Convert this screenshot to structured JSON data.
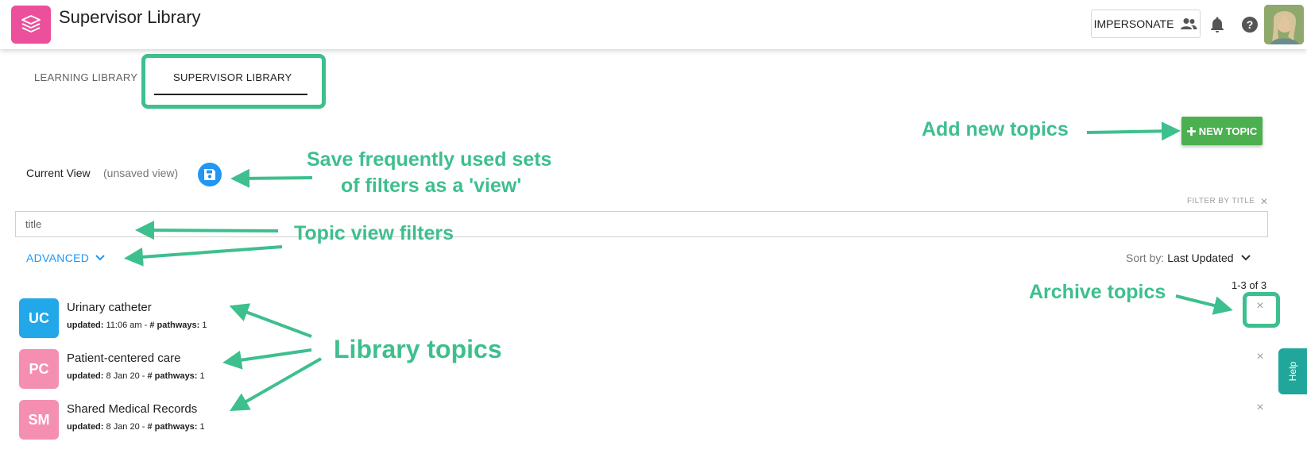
{
  "app": {
    "title": "Supervisor Library"
  },
  "header": {
    "impersonate_label": "IMPERSONATE",
    "icons": [
      "layers-book-icon",
      "people-icon",
      "bell-icon",
      "help-circle-icon"
    ]
  },
  "tabs": [
    {
      "label": "LEARNING LIBRARY",
      "active": false
    },
    {
      "label": "SUPERVISOR LIBRARY",
      "active": true
    }
  ],
  "toolbar": {
    "new_topic_label": "NEW TOPIC"
  },
  "view": {
    "current_label": "Current View",
    "state_label": "(unsaved view)"
  },
  "filter": {
    "caption": "FILTER BY TITLE",
    "clear_symbol": "✕",
    "placeholder": "title",
    "value": ""
  },
  "advanced_label": "ADVANCED",
  "sort": {
    "label": "Sort by:",
    "value": "Last Updated"
  },
  "results_count": "1-3 of 3",
  "topics": [
    {
      "initials": "UC",
      "title": "Urinary catheter",
      "updated": "11:06 am",
      "pathways": "1",
      "color": "#22a7e8"
    },
    {
      "initials": "PC",
      "title": "Patient-centered care",
      "updated": "8 Jan 20",
      "pathways": "1",
      "color": "#f48fb1"
    },
    {
      "initials": "SM",
      "title": "Shared Medical Records",
      "updated": "8 Jan 20",
      "pathways": "1",
      "color": "#f48fb1"
    }
  ],
  "meta_labels": {
    "updated": "updated:",
    "separator": " - ",
    "pathways": "# pathways:"
  },
  "archive_symbol": "×",
  "help_tab_label": "Help",
  "annotations": {
    "add_topics": "Add new topics",
    "save_views_line1": "Save frequently used sets",
    "save_views_line2": "of filters as a 'view'",
    "topic_filters": "Topic view filters",
    "archive": "Archive topics",
    "library": "Library topics"
  },
  "colors": {
    "logo": "#ec4f9b",
    "accent_blue": "#2196f3",
    "new_topic_green": "#4caf50",
    "annotation_green": "#3dbf8e",
    "help_tab": "#20a69a"
  }
}
